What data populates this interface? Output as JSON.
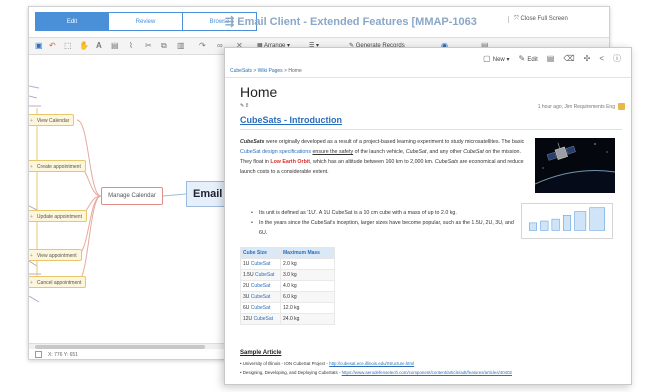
{
  "editor": {
    "mode_tabs": [
      "Edit",
      "Review",
      "Browse"
    ],
    "title": "Email Client - Extended Features [MMAP-1063",
    "fullscreen_label": "Close Full Screen",
    "toolbar": {
      "arrange_label": "Arrange",
      "generate_label": "Generate Records"
    },
    "nodes": {
      "view_calendar": "View Calendar",
      "create_appointment": "Create appointment",
      "update_appointment": "Update appointment",
      "view_appointment": "View appointment",
      "cancel_appointment": "Cancel appointment",
      "manage_calendar": "Manage Calendar",
      "root": "Email C"
    },
    "status_coords": "X: 776 Y: 651"
  },
  "wiki": {
    "actions": {
      "new_label": "New",
      "edit_label": "Edit"
    },
    "breadcrumb": [
      "CubeSats",
      ">",
      "Wiki Pages",
      ">",
      "Home"
    ],
    "page_title": "Home",
    "edit_count": "8",
    "updated": "1 hour ago, Jim Requirements Eng",
    "section_heading": "CubeSats - Introduction",
    "intro": {
      "p1": "CubeSats",
      "p2": " were originally developed as a result of a project-based learning experiment to study microsatellites. The basic ",
      "p3": "CubeSat design specifications",
      "p4": " ",
      "p5": "ensure the safety",
      "p6": " of the launch vehicle, ",
      "p7": "CubeSat",
      "p8": ", and any other ",
      "p9": "CubeSat",
      "p10": " on the mission. They float in ",
      "p11": "Low Earth Orbit",
      "p12": ", which has an altitude between 160 km to 2,000 km. ",
      "p13": "CubeSats",
      "p14": " are economical and reduce launch costs to a considerable extent."
    },
    "bullets": [
      "Its unit is defined as '1U'. A 1U CubeSat is a 10 cm cube with a mass of up to 2.0 kg.",
      "In the years since the CubeSat's inception, larger sizes have become popular, such as the 1.5U, 2U, 3U, and 6U."
    ],
    "table": {
      "headers": [
        "Cube Size",
        "Maximum Mass"
      ],
      "rows": [
        {
          "size": "1U",
          "link": "CubeSat",
          "mass": "2.0 kg"
        },
        {
          "size": "1.5U",
          "link": "CubeSat",
          "mass": "3.0 kg"
        },
        {
          "size": "2U",
          "link": "CubeSat",
          "mass": "4.0 kg"
        },
        {
          "size": "3U",
          "link": "CubeSat",
          "mass": "6.0 kg"
        },
        {
          "size": "6U",
          "link": "CubeSat",
          "mass": "12.0 kg"
        },
        {
          "size": "12U",
          "link": "CubeSat",
          "mass": "24.0 kg"
        }
      ]
    },
    "sample_heading": "Sample Article",
    "references": [
      {
        "text": "University of Illinois - ION CubeSat Project - ",
        "link": "http://cubesat.ece.illinois.edu/Structure.html"
      },
      {
        "text": "Designing, Developing, and Deploying CubeSats - ",
        "link": "https://www.aerodefensetech.com/component/content/article/adt/features/articles/40402"
      }
    ]
  },
  "colors": {
    "accent": "#4a90d9",
    "link": "#2a6ebb",
    "alert_red": "#d8302a",
    "node_fill": "#fdf6dc",
    "node_border": "#e7c76b"
  }
}
